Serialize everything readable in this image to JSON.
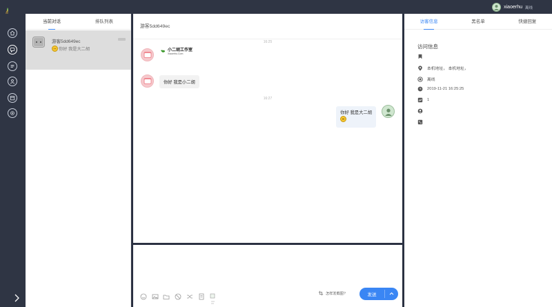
{
  "topbar": {
    "username": "xiaoerhu",
    "status": "离线"
  },
  "conversation_tabs": [
    "当前对话",
    "排队列表"
  ],
  "conversation": {
    "name": "游客5dd649ec",
    "last_message": "你好 我是大二胡"
  },
  "chat": {
    "title": "游客5dd649ec",
    "times": [
      "16:25",
      "16:27"
    ],
    "brand_name": "小二胡工作室",
    "brand_site": "Xiaoerhu.Com",
    "messages": [
      {
        "side": "left",
        "text": "你好 我是小二胡"
      },
      {
        "side": "right",
        "text": "你好 我是大二胡"
      }
    ]
  },
  "input": {
    "screenshot_help": "怎样发截图?",
    "send_label": "发送"
  },
  "right_tabs": [
    "访客信息",
    "黑名单",
    "快捷回复"
  ],
  "visitor": {
    "title": "访问信息",
    "location": "本机地址， 本机地址，",
    "status": "离线",
    "time": "2019-11-21 16:25:25",
    "visits": "1"
  },
  "colors": {
    "accent": "#3a86f4",
    "sidebar": "#2f3544"
  }
}
